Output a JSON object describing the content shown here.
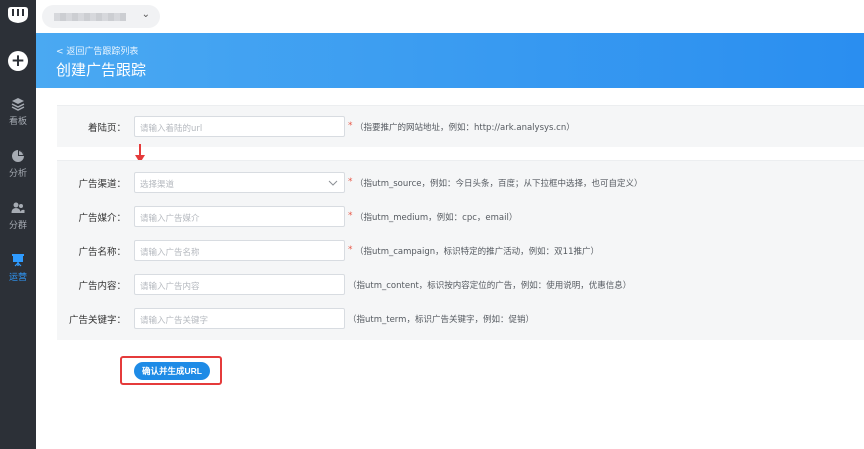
{
  "sidebar": {
    "add_symbol": "+",
    "items": [
      {
        "label": "看板",
        "icon": "layers-icon"
      },
      {
        "label": "分析",
        "icon": "pie-chart-icon"
      },
      {
        "label": "分群",
        "icon": "users-icon"
      },
      {
        "label": "运营",
        "icon": "presentation-board-icon"
      }
    ],
    "active_color": "#2f9bff"
  },
  "topbar": {
    "project_chevron": "⌄"
  },
  "header": {
    "back_link": "< 返回广告跟踪列表",
    "title": "创建广告跟踪"
  },
  "form": {
    "landing": {
      "label": "着陆页：",
      "placeholder": "请输入着陆的url",
      "required": "*",
      "hint": "（指要推广的网站地址，例如：http://ark.analysys.cn）"
    },
    "channel": {
      "label": "广告渠道：",
      "placeholder": "选择渠道",
      "required": "*",
      "hint": "（指utm_source，例如：今日头条，百度；从下拉框中选择，也可自定义）"
    },
    "medium": {
      "label": "广告媒介：",
      "placeholder": "请输入广告媒介",
      "required": "*",
      "hint": "（指utm_medium，例如：cpc，email）"
    },
    "campaign": {
      "label": "广告名称：",
      "placeholder": "请输入广告名称",
      "required": "*",
      "hint": "（指utm_campaign，标识特定的推广活动，例如：双11推广）"
    },
    "content": {
      "label": "广告内容：",
      "placeholder": "请输入广告内容",
      "hint": "（指utm_content，标识按内容定位的广告，例如：使用说明，优惠信息）"
    },
    "keyword": {
      "label": "广告关键字：",
      "placeholder": "请输入广告关键字",
      "hint": "（指utm_term，标识广告关键字，例如：促销）"
    }
  },
  "submit": {
    "label": "确认并生成URL"
  },
  "colors": {
    "banner": "#2a8ef0",
    "button": "#1e8be6",
    "highlight": "#e53b3b"
  }
}
